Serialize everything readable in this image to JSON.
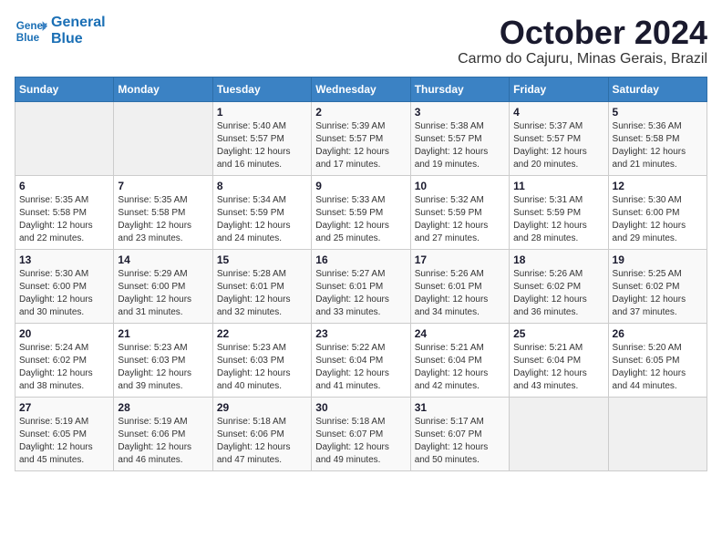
{
  "header": {
    "logo_line1": "General",
    "logo_line2": "Blue",
    "title": "October 2024",
    "subtitle": "Carmo do Cajuru, Minas Gerais, Brazil"
  },
  "weekdays": [
    "Sunday",
    "Monday",
    "Tuesday",
    "Wednesday",
    "Thursday",
    "Friday",
    "Saturday"
  ],
  "weeks": [
    [
      {
        "day": "",
        "sunrise": "",
        "sunset": "",
        "daylight": ""
      },
      {
        "day": "",
        "sunrise": "",
        "sunset": "",
        "daylight": ""
      },
      {
        "day": "1",
        "sunrise": "Sunrise: 5:40 AM",
        "sunset": "Sunset: 5:57 PM",
        "daylight": "Daylight: 12 hours and 16 minutes."
      },
      {
        "day": "2",
        "sunrise": "Sunrise: 5:39 AM",
        "sunset": "Sunset: 5:57 PM",
        "daylight": "Daylight: 12 hours and 17 minutes."
      },
      {
        "day": "3",
        "sunrise": "Sunrise: 5:38 AM",
        "sunset": "Sunset: 5:57 PM",
        "daylight": "Daylight: 12 hours and 19 minutes."
      },
      {
        "day": "4",
        "sunrise": "Sunrise: 5:37 AM",
        "sunset": "Sunset: 5:57 PM",
        "daylight": "Daylight: 12 hours and 20 minutes."
      },
      {
        "day": "5",
        "sunrise": "Sunrise: 5:36 AM",
        "sunset": "Sunset: 5:58 PM",
        "daylight": "Daylight: 12 hours and 21 minutes."
      }
    ],
    [
      {
        "day": "6",
        "sunrise": "Sunrise: 5:35 AM",
        "sunset": "Sunset: 5:58 PM",
        "daylight": "Daylight: 12 hours and 22 minutes."
      },
      {
        "day": "7",
        "sunrise": "Sunrise: 5:35 AM",
        "sunset": "Sunset: 5:58 PM",
        "daylight": "Daylight: 12 hours and 23 minutes."
      },
      {
        "day": "8",
        "sunrise": "Sunrise: 5:34 AM",
        "sunset": "Sunset: 5:59 PM",
        "daylight": "Daylight: 12 hours and 24 minutes."
      },
      {
        "day": "9",
        "sunrise": "Sunrise: 5:33 AM",
        "sunset": "Sunset: 5:59 PM",
        "daylight": "Daylight: 12 hours and 25 minutes."
      },
      {
        "day": "10",
        "sunrise": "Sunrise: 5:32 AM",
        "sunset": "Sunset: 5:59 PM",
        "daylight": "Daylight: 12 hours and 27 minutes."
      },
      {
        "day": "11",
        "sunrise": "Sunrise: 5:31 AM",
        "sunset": "Sunset: 5:59 PM",
        "daylight": "Daylight: 12 hours and 28 minutes."
      },
      {
        "day": "12",
        "sunrise": "Sunrise: 5:30 AM",
        "sunset": "Sunset: 6:00 PM",
        "daylight": "Daylight: 12 hours and 29 minutes."
      }
    ],
    [
      {
        "day": "13",
        "sunrise": "Sunrise: 5:30 AM",
        "sunset": "Sunset: 6:00 PM",
        "daylight": "Daylight: 12 hours and 30 minutes."
      },
      {
        "day": "14",
        "sunrise": "Sunrise: 5:29 AM",
        "sunset": "Sunset: 6:00 PM",
        "daylight": "Daylight: 12 hours and 31 minutes."
      },
      {
        "day": "15",
        "sunrise": "Sunrise: 5:28 AM",
        "sunset": "Sunset: 6:01 PM",
        "daylight": "Daylight: 12 hours and 32 minutes."
      },
      {
        "day": "16",
        "sunrise": "Sunrise: 5:27 AM",
        "sunset": "Sunset: 6:01 PM",
        "daylight": "Daylight: 12 hours and 33 minutes."
      },
      {
        "day": "17",
        "sunrise": "Sunrise: 5:26 AM",
        "sunset": "Sunset: 6:01 PM",
        "daylight": "Daylight: 12 hours and 34 minutes."
      },
      {
        "day": "18",
        "sunrise": "Sunrise: 5:26 AM",
        "sunset": "Sunset: 6:02 PM",
        "daylight": "Daylight: 12 hours and 36 minutes."
      },
      {
        "day": "19",
        "sunrise": "Sunrise: 5:25 AM",
        "sunset": "Sunset: 6:02 PM",
        "daylight": "Daylight: 12 hours and 37 minutes."
      }
    ],
    [
      {
        "day": "20",
        "sunrise": "Sunrise: 5:24 AM",
        "sunset": "Sunset: 6:02 PM",
        "daylight": "Daylight: 12 hours and 38 minutes."
      },
      {
        "day": "21",
        "sunrise": "Sunrise: 5:23 AM",
        "sunset": "Sunset: 6:03 PM",
        "daylight": "Daylight: 12 hours and 39 minutes."
      },
      {
        "day": "22",
        "sunrise": "Sunrise: 5:23 AM",
        "sunset": "Sunset: 6:03 PM",
        "daylight": "Daylight: 12 hours and 40 minutes."
      },
      {
        "day": "23",
        "sunrise": "Sunrise: 5:22 AM",
        "sunset": "Sunset: 6:04 PM",
        "daylight": "Daylight: 12 hours and 41 minutes."
      },
      {
        "day": "24",
        "sunrise": "Sunrise: 5:21 AM",
        "sunset": "Sunset: 6:04 PM",
        "daylight": "Daylight: 12 hours and 42 minutes."
      },
      {
        "day": "25",
        "sunrise": "Sunrise: 5:21 AM",
        "sunset": "Sunset: 6:04 PM",
        "daylight": "Daylight: 12 hours and 43 minutes."
      },
      {
        "day": "26",
        "sunrise": "Sunrise: 5:20 AM",
        "sunset": "Sunset: 6:05 PM",
        "daylight": "Daylight: 12 hours and 44 minutes."
      }
    ],
    [
      {
        "day": "27",
        "sunrise": "Sunrise: 5:19 AM",
        "sunset": "Sunset: 6:05 PM",
        "daylight": "Daylight: 12 hours and 45 minutes."
      },
      {
        "day": "28",
        "sunrise": "Sunrise: 5:19 AM",
        "sunset": "Sunset: 6:06 PM",
        "daylight": "Daylight: 12 hours and 46 minutes."
      },
      {
        "day": "29",
        "sunrise": "Sunrise: 5:18 AM",
        "sunset": "Sunset: 6:06 PM",
        "daylight": "Daylight: 12 hours and 47 minutes."
      },
      {
        "day": "30",
        "sunrise": "Sunrise: 5:18 AM",
        "sunset": "Sunset: 6:07 PM",
        "daylight": "Daylight: 12 hours and 49 minutes."
      },
      {
        "day": "31",
        "sunrise": "Sunrise: 5:17 AM",
        "sunset": "Sunset: 6:07 PM",
        "daylight": "Daylight: 12 hours and 50 minutes."
      },
      {
        "day": "",
        "sunrise": "",
        "sunset": "",
        "daylight": ""
      },
      {
        "day": "",
        "sunrise": "",
        "sunset": "",
        "daylight": ""
      }
    ]
  ]
}
